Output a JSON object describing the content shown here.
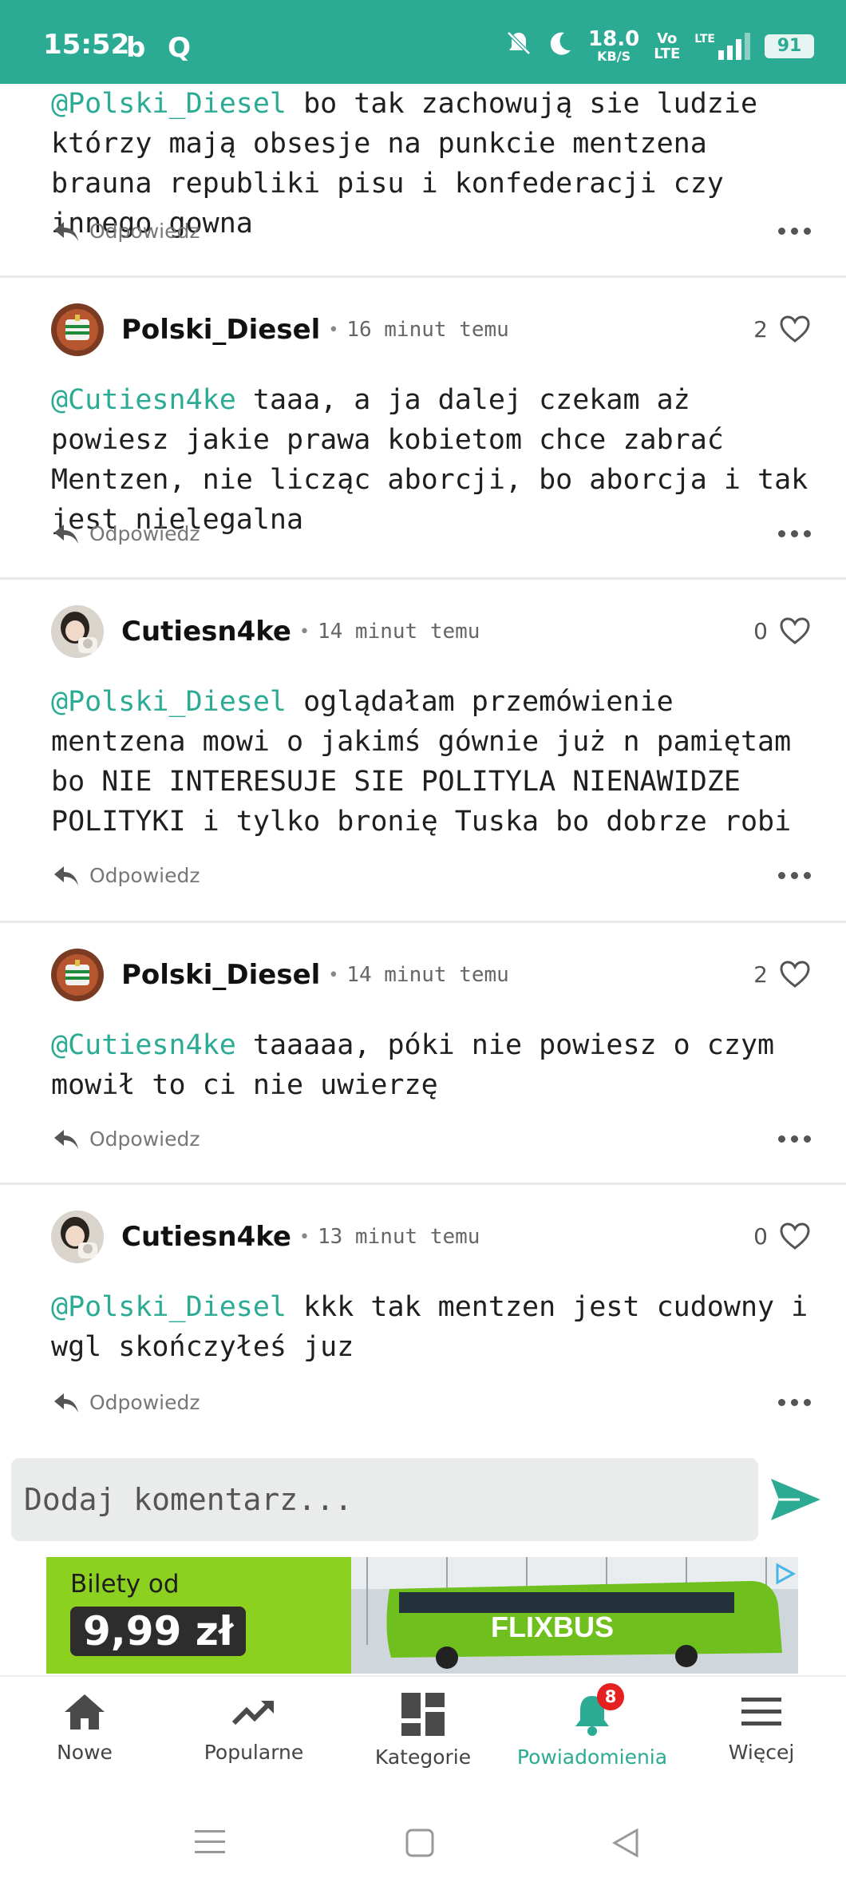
{
  "status_bar": {
    "time": "15:52",
    "left_icons": "b Q",
    "speed_value": "18.0",
    "speed_unit": "KB/S",
    "volte_top": "Vo",
    "volte_bottom": "LTE",
    "lte": "LTE",
    "battery": "91"
  },
  "comments": [
    {
      "author": "",
      "time": "",
      "likes": "",
      "mention": "@Polski_Diesel",
      "text": " bo tak zachowują sie ludzie którzy mają obsesje na punkcie mentzena brauna republiki pisu i konfederacji czy innego gowna",
      "reply": "Odpowiedz"
    },
    {
      "author": "Polski_Diesel",
      "time": "16 minut temu",
      "likes": "2",
      "mention": "@Cutiesn4ke",
      "text": " taaa, a ja dalej czekam aż powiesz jakie prawa kobietom chce zabrać Mentzen, nie licząc aborcji, bo aborcja i tak jest nielegalna",
      "reply": "Odpowiedz"
    },
    {
      "author": "Cutiesn4ke",
      "time": "14 minut temu",
      "likes": "0",
      "mention": "@Polski_Diesel",
      "text": " oglądałam przemówienie mentzena mowi o jakimś gównie już n pamiętam bo NIE INTERESUJE SIE POLITYLA NIENAWIDZE POLITYKI i tylko bronię Tuska bo dobrze robi",
      "reply": "Odpowiedz"
    },
    {
      "author": "Polski_Diesel",
      "time": "14 minut temu",
      "likes": "2",
      "mention": "@Cutiesn4ke",
      "text": " taaaaa, póki nie powiesz o czym mowił to ci nie uwierzę",
      "reply": "Odpowiedz"
    },
    {
      "author": "Cutiesn4ke",
      "time": "13 minut temu",
      "likes": "0",
      "mention": "@Polski_Diesel",
      "text": " kkk tak mentzen jest cudowny i wgl skończyłeś juz",
      "reply": "Odpowiedz"
    }
  ],
  "comment_input": {
    "placeholder": "Dodaj komentarz..."
  },
  "ad": {
    "line1": "Bilety od",
    "price": "9,99 zł",
    "brand": "FLIXBUS"
  },
  "bottom_nav": [
    {
      "label": "Nowe",
      "icon": "home-icon"
    },
    {
      "label": "Popularne",
      "icon": "trending-icon"
    },
    {
      "label": "Kategorie",
      "icon": "categories-icon"
    },
    {
      "label": "Powiadomienia",
      "icon": "bell-icon",
      "badge": "8"
    },
    {
      "label": "Więcej",
      "icon": "menu-icon"
    }
  ],
  "colors": {
    "accent": "#2bab94",
    "badge": "#e52020",
    "ad_green": "#8cd11f"
  }
}
